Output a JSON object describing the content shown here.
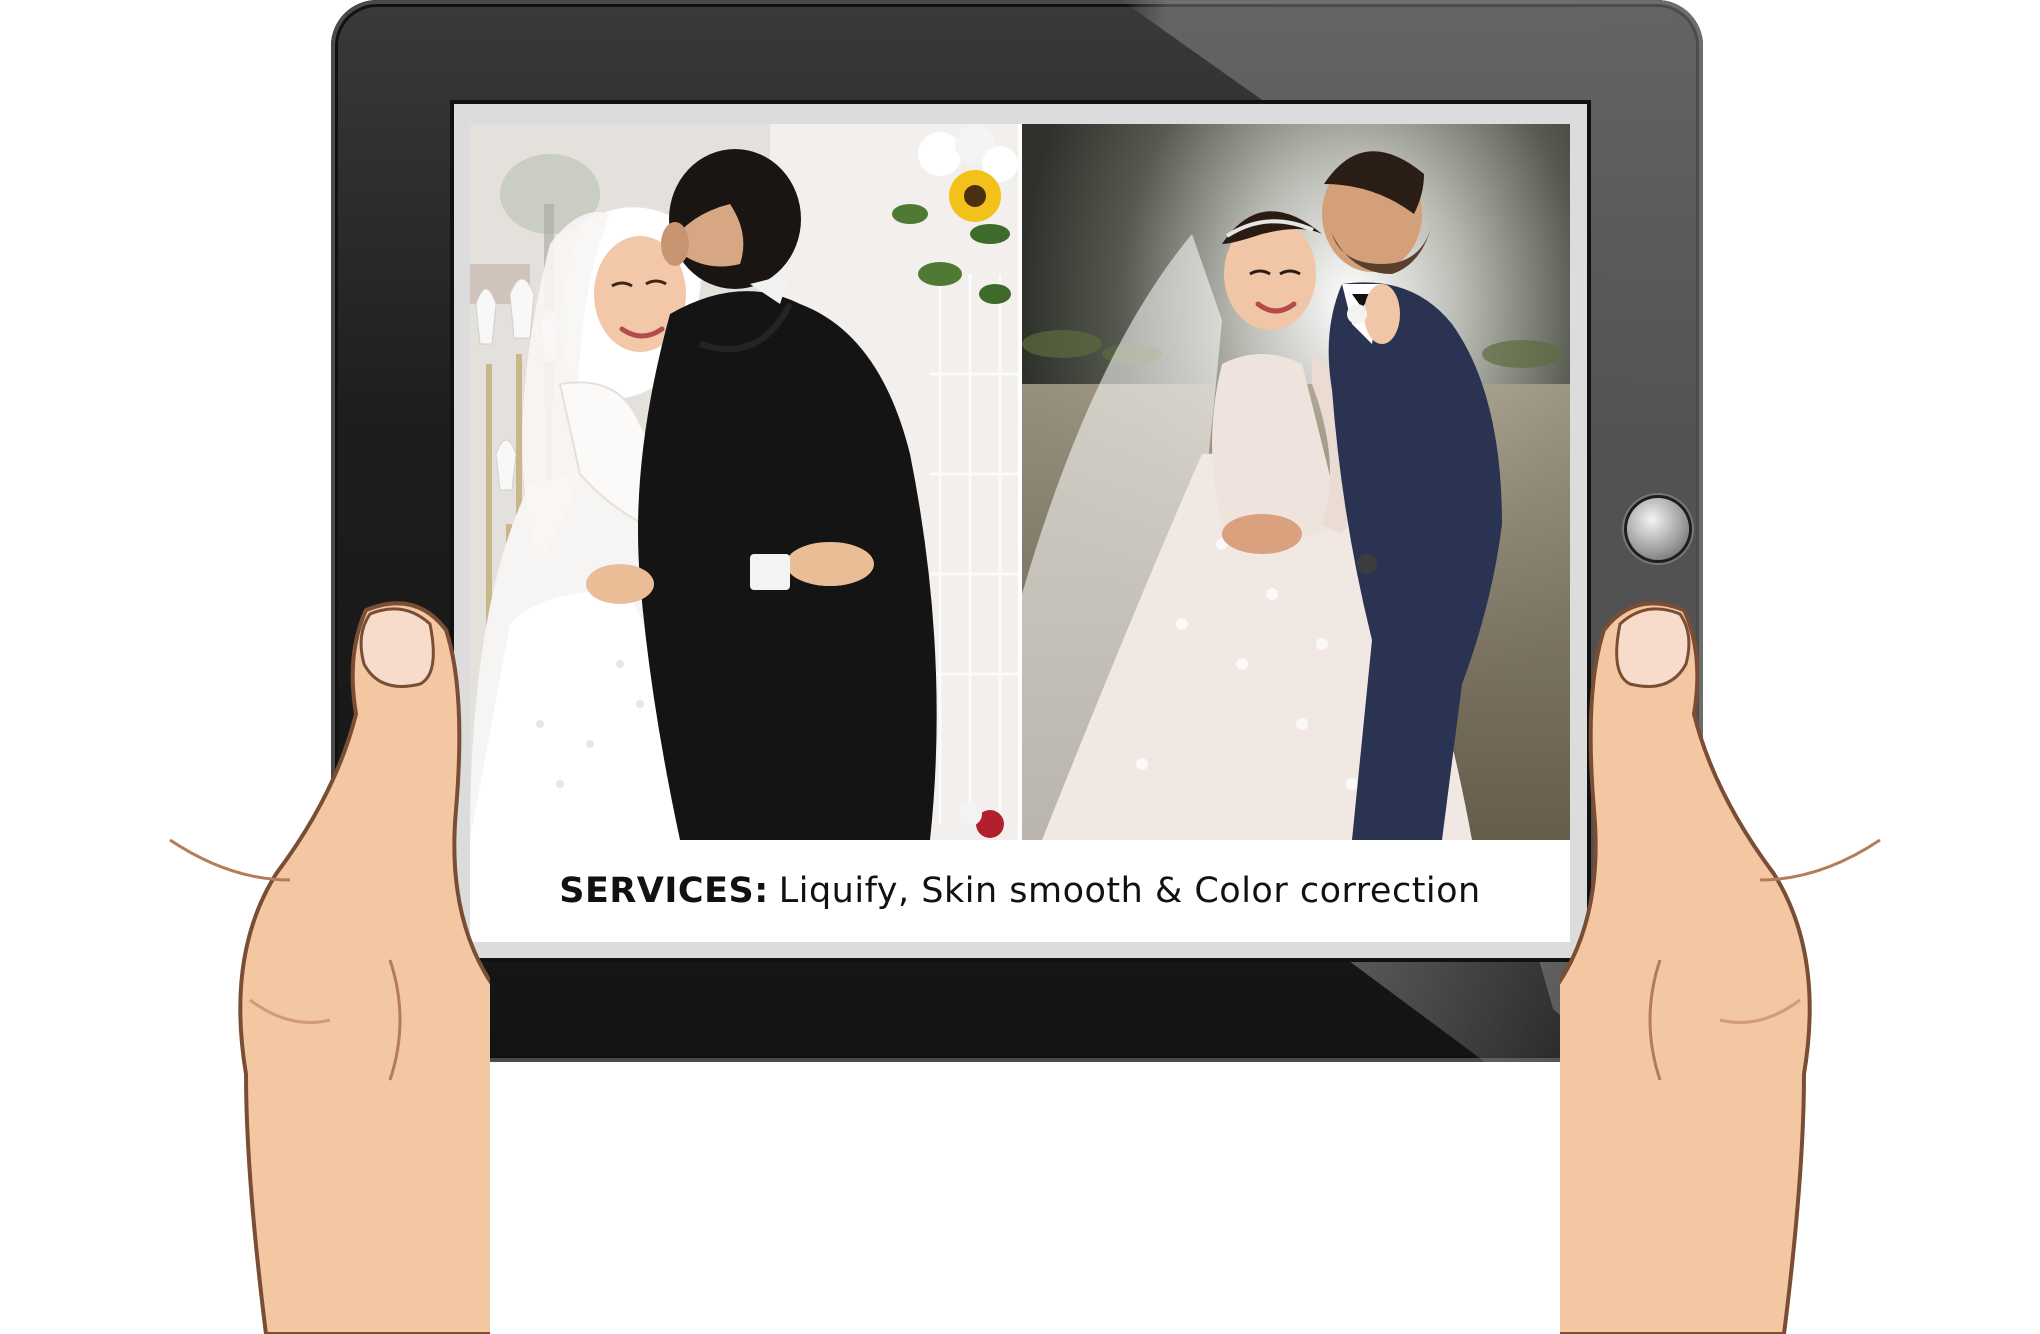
{
  "caption": {
    "label": "SERVICES",
    "separator": ":",
    "text": "Liquify, Skin smooth & Color correction"
  },
  "colors": {
    "tablet_body": "#1b1b1b",
    "skin": "#f3c9a5",
    "skin_outline": "#8a5a3a",
    "suit_dark": "#161616",
    "suit_navy": "#2b3352",
    "dress_white": "#f6f4f2"
  },
  "icons": {
    "home_button": "home-button-icon"
  }
}
